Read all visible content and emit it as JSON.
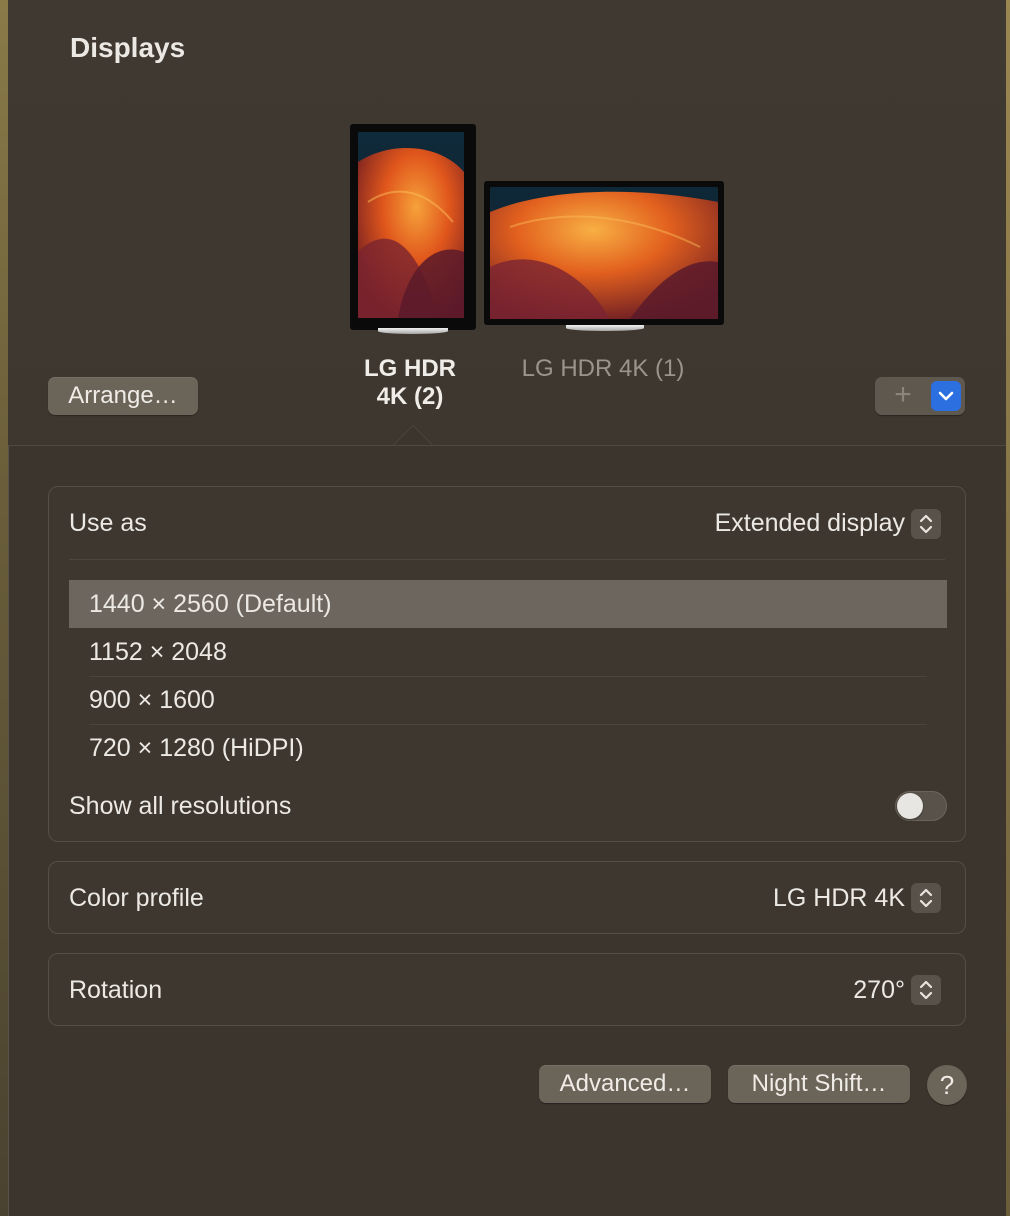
{
  "window": {
    "title": "Displays"
  },
  "displays": [
    {
      "name": "LG HDR 4K (2)",
      "name_line1": "LG HDR",
      "name_line2": "4K (2)",
      "selected": true
    },
    {
      "name": "LG HDR 4K (1)",
      "selected": false
    }
  ],
  "toolbar": {
    "arrange_label": "Arrange…",
    "add_label": "+"
  },
  "use_as": {
    "label": "Use as",
    "value": "Extended display"
  },
  "resolutions": {
    "items": [
      "1440 × 2560 (Default)",
      "1152 × 2048",
      "900 × 1600",
      "720 × 1280 (HiDPI)"
    ],
    "selected_index": 0,
    "show_all_label": "Show all resolutions",
    "show_all_on": false
  },
  "color_profile": {
    "label": "Color profile",
    "value": "LG HDR 4K"
  },
  "rotation": {
    "label": "Rotation",
    "value": "270°"
  },
  "footer": {
    "advanced_label": "Advanced…",
    "night_shift_label": "Night Shift…",
    "help_label": "?"
  },
  "colors": {
    "background": "#3b352d",
    "accent": "#2c6fe0",
    "selected_row": "#6d665e"
  }
}
